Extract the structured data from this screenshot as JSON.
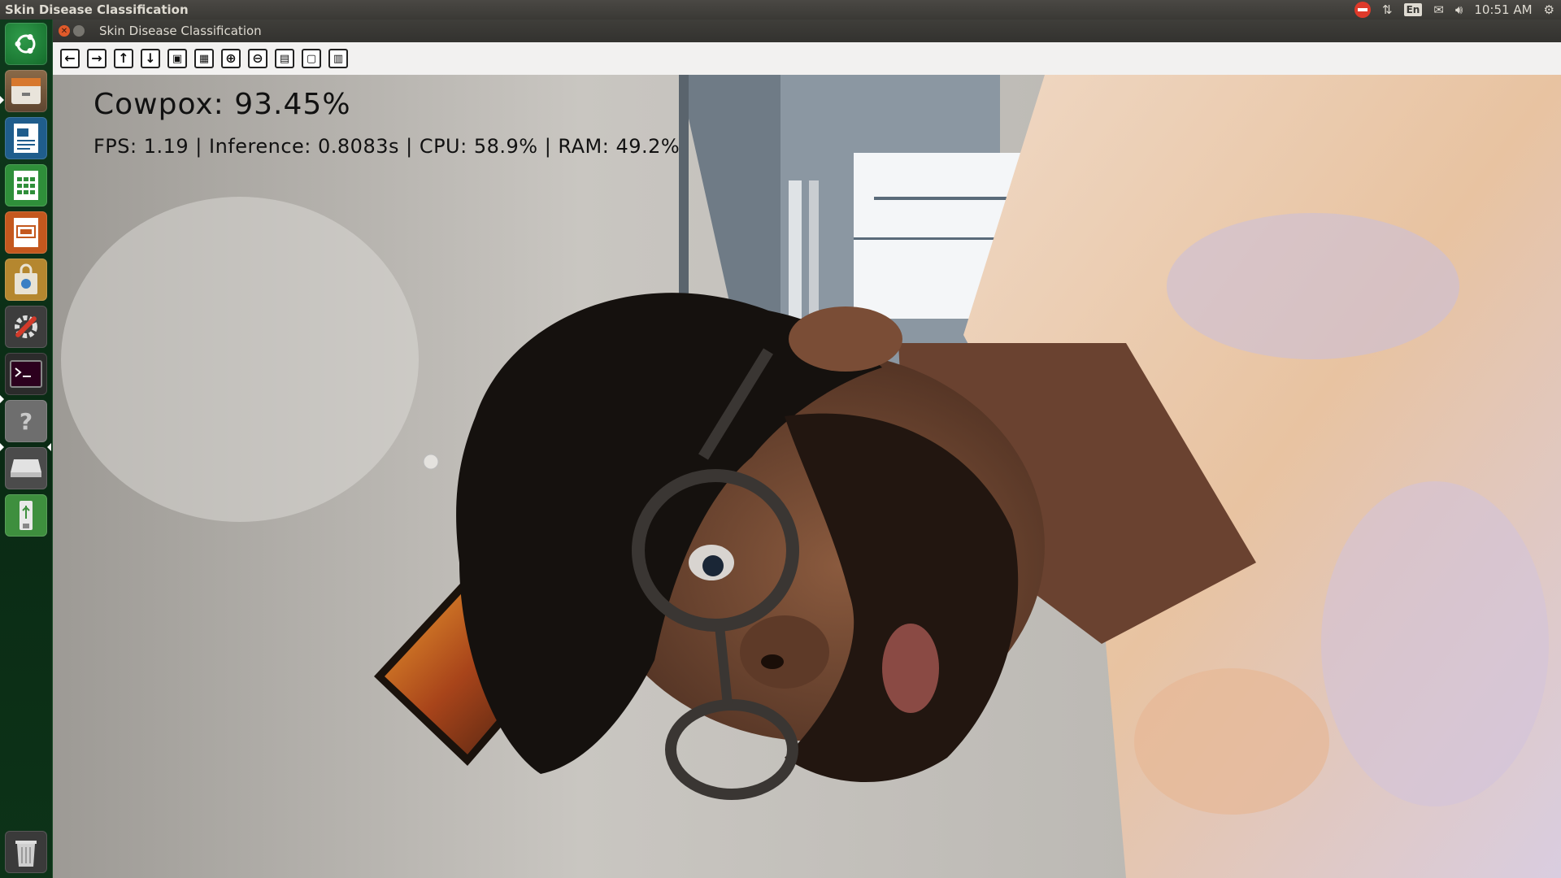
{
  "topbar": {
    "app_title": "Skin Disease Classification",
    "indicators": {
      "keyboard": "En",
      "time": "10:51 AM"
    }
  },
  "launcher": {
    "items": [
      {
        "name": "ubuntu-dash-button",
        "icon": "ubuntu-logo-icon"
      },
      {
        "name": "files-launcher",
        "icon": "file-cabinet-icon"
      },
      {
        "name": "writer-launcher",
        "icon": "document-icon"
      },
      {
        "name": "calc-launcher",
        "icon": "spreadsheet-icon"
      },
      {
        "name": "impress-launcher",
        "icon": "presentation-icon"
      },
      {
        "name": "software-center-launcher",
        "icon": "shopping-bag-icon"
      },
      {
        "name": "system-settings-launcher",
        "icon": "wrench-gear-icon"
      },
      {
        "name": "terminal-launcher",
        "icon": "terminal-icon"
      },
      {
        "name": "help-launcher",
        "icon": "question-mark-icon"
      },
      {
        "name": "drive-launcher",
        "icon": "hard-drive-icon"
      },
      {
        "name": "usb-launcher",
        "icon": "usb-drive-icon"
      },
      {
        "name": "trash-launcher",
        "icon": "trash-icon"
      }
    ]
  },
  "window": {
    "title": "Skin Disease Classification",
    "toolbar": [
      {
        "name": "pan-left-button",
        "glyph": "←"
      },
      {
        "name": "pan-right-button",
        "glyph": "→"
      },
      {
        "name": "pan-up-button",
        "glyph": "↑"
      },
      {
        "name": "pan-down-button",
        "glyph": "↓"
      },
      {
        "name": "zoom-image-button",
        "glyph": "▣"
      },
      {
        "name": "zoom-fit-button",
        "glyph": "▦"
      },
      {
        "name": "zoom-in-button",
        "glyph": "+"
      },
      {
        "name": "zoom-out-button",
        "glyph": "−"
      },
      {
        "name": "save-image-button",
        "glyph": "▤"
      },
      {
        "name": "copy-clipboard-button",
        "glyph": "▢"
      },
      {
        "name": "properties-button",
        "glyph": "▥"
      }
    ]
  },
  "viewport": {
    "prediction": "Cowpox: 93.45%",
    "stats": "FPS: 1.19 | Inference: 0.8083s | CPU: 58.9% | RAM: 49.2%"
  },
  "colors": {
    "launcher_bg": "#0f3a1c",
    "panel_bg": "#3a3935",
    "close_button": "#e05a2a",
    "overlay_text": "#111111"
  }
}
